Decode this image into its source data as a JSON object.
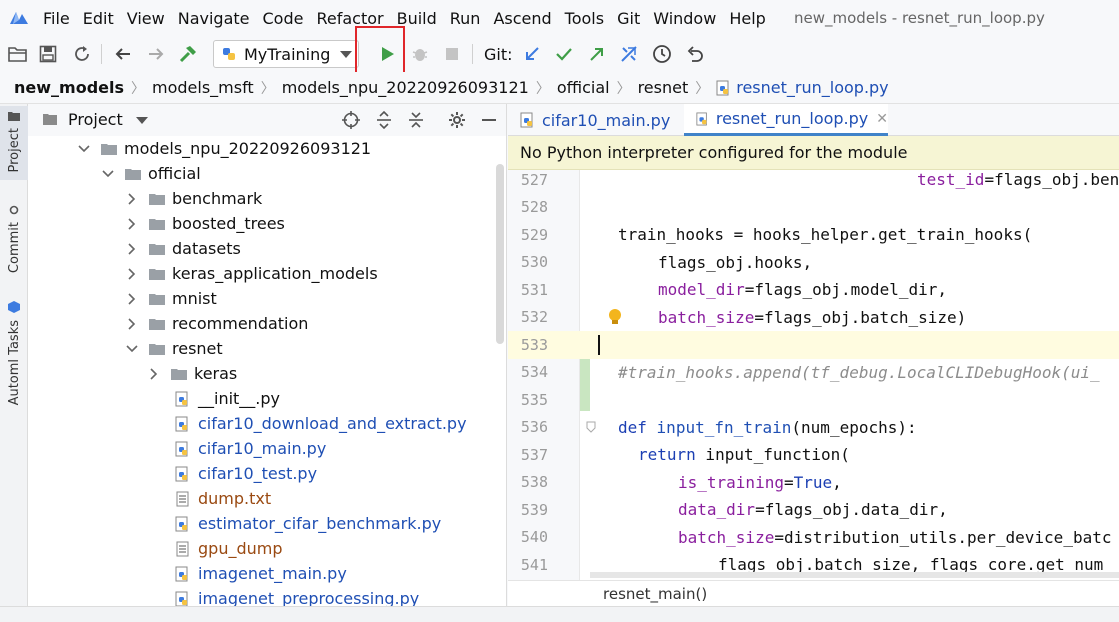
{
  "menu": {
    "items": [
      "File",
      "Edit",
      "View",
      "Navigate",
      "Code",
      "Refactor",
      "Build",
      "Run",
      "Ascend",
      "Tools",
      "Git",
      "Window",
      "Help"
    ],
    "window_title": "new_models - resnet_run_loop.py"
  },
  "toolbar": {
    "run_config": "MyTraining",
    "git_label": "Git:"
  },
  "breadcrumb": {
    "items": [
      "new_models",
      "models_msft",
      "models_npu_20220926093121",
      "official",
      "resnet"
    ],
    "file": "resnet_run_loop.py"
  },
  "stripe": {
    "project": "Project",
    "commit": "Commit",
    "automl": "Automl Tasks"
  },
  "project_panel": {
    "title": "Project",
    "tree": [
      {
        "label": "models_npu_20220926093121",
        "type": "folder",
        "open": true
      },
      {
        "label": "official",
        "type": "folder",
        "open": true
      },
      {
        "label": "benchmark",
        "type": "folder",
        "open": false
      },
      {
        "label": "boosted_trees",
        "type": "folder",
        "open": false
      },
      {
        "label": "datasets",
        "type": "folder",
        "open": false
      },
      {
        "label": "keras_application_models",
        "type": "folder",
        "open": false
      },
      {
        "label": "mnist",
        "type": "folder",
        "open": false
      },
      {
        "label": "recommendation",
        "type": "folder",
        "open": false
      },
      {
        "label": "resnet",
        "type": "folder",
        "open": true
      },
      {
        "label": "keras",
        "type": "folder",
        "open": false
      },
      {
        "label": "__init__.py",
        "type": "py-plain"
      },
      {
        "label": "cifar10_download_and_extract.py",
        "type": "py"
      },
      {
        "label": "cifar10_main.py",
        "type": "py"
      },
      {
        "label": "cifar10_test.py",
        "type": "py"
      },
      {
        "label": "dump.txt",
        "type": "txt"
      },
      {
        "label": "estimator_cifar_benchmark.py",
        "type": "py"
      },
      {
        "label": "gpu_dump",
        "type": "txt"
      },
      {
        "label": "imagenet_main.py",
        "type": "py"
      },
      {
        "label": "imagenet_preprocessing.py",
        "type": "py"
      }
    ]
  },
  "editor": {
    "tabs": [
      "cifar10_main.py",
      "resnet_run_loop.py"
    ],
    "notice": "No Python interpreter configured for the module",
    "line_numbers": [
      "527",
      "528",
      "529",
      "530",
      "531",
      "532",
      "533",
      "534",
      "535",
      "536",
      "537",
      "538",
      "539",
      "540",
      "541"
    ],
    "status_crumb": "resnet_main()"
  },
  "colors": {
    "accent": "#4083c9",
    "run_green": "#3f9e47",
    "highlight_red": "#e0262a",
    "notice_bg": "#f6f5d4"
  }
}
